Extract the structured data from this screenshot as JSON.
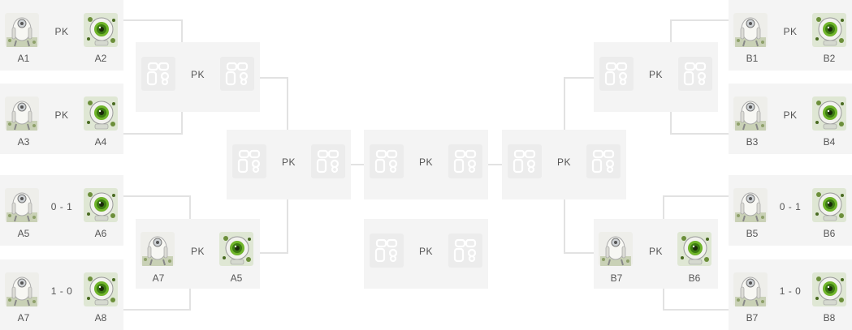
{
  "pk_label": "PK",
  "first_round_left": [
    {
      "id": "left-r1-m1",
      "left_name": "A1",
      "right_name": "A2",
      "center": "PK"
    },
    {
      "id": "left-r1-m2",
      "left_name": "A3",
      "right_name": "A4",
      "center": "PK"
    },
    {
      "id": "left-r1-m3",
      "left_name": "A5",
      "right_name": "A6",
      "center": "0 - 1"
    },
    {
      "id": "left-r1-m4",
      "left_name": "A7",
      "right_name": "A8",
      "center": "1 - 0"
    }
  ],
  "first_round_right": [
    {
      "id": "right-r1-m1",
      "left_name": "B1",
      "right_name": "B2",
      "center": "PK"
    },
    {
      "id": "right-r1-m2",
      "left_name": "B3",
      "right_name": "B4",
      "center": "PK"
    },
    {
      "id": "right-r1-m3",
      "left_name": "B5",
      "right_name": "B6",
      "center": "0 - 1"
    },
    {
      "id": "right-r1-m4",
      "left_name": "B7",
      "right_name": "B8",
      "center": "1 - 0"
    }
  ],
  "second_round_left": {
    "top": {
      "center": "PK"
    },
    "bottom": {
      "left_name": "A7",
      "right_name": "A5",
      "center": "PK"
    }
  },
  "second_round_right": {
    "top": {
      "center": "PK"
    },
    "bottom": {
      "left_name": "B7",
      "right_name": "B6",
      "center": "PK"
    }
  },
  "semi_left": {
    "center": "PK"
  },
  "semi_right": {
    "center": "PK"
  },
  "final": {
    "center": "PK"
  },
  "third_place": {
    "center": "PK"
  },
  "colors": {
    "box_bg": "#f4f4f4",
    "line": "#e2e2e2",
    "placeholder": "#e6e6e6",
    "text": "#555555"
  }
}
